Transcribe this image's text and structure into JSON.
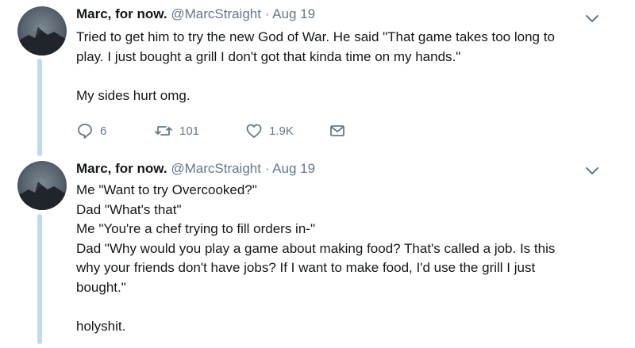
{
  "tweets": [
    {
      "author": "Marc, for now.",
      "handle": "@MarcStraight",
      "dot": "·",
      "date": "Aug 19",
      "lines": [
        "Tried to get him to try the new God of War. He said \"That game takes too long to",
        "play. I just bought a grill I don't got that kinda time on my hands.\"",
        "",
        "My sides hurt omg."
      ],
      "actions": {
        "replies": "6",
        "retweets": "101",
        "likes": "1.9K"
      }
    },
    {
      "author": "Marc, for now.",
      "handle": "@MarcStraight",
      "dot": "·",
      "date": "Aug 19",
      "lines": [
        "Me \"Want to try Overcooked?\"",
        "Dad \"What's that\"",
        "Me \"You're a chef trying to fill orders in-\"",
        "Dad \"Why would you play a game about making food? That's called a job. Is this",
        "why your friends don't have jobs? If I want to make food, I'd use the grill I just",
        "bought.\"",
        "",
        "holyshit."
      ]
    }
  ],
  "colors": {
    "text": "#14171a",
    "secondary": "#657786",
    "thread_line": "#c4d9ec"
  },
  "icons": [
    "avatar",
    "chevron-down-icon",
    "reply-icon",
    "retweet-icon",
    "like-icon",
    "message-icon"
  ]
}
